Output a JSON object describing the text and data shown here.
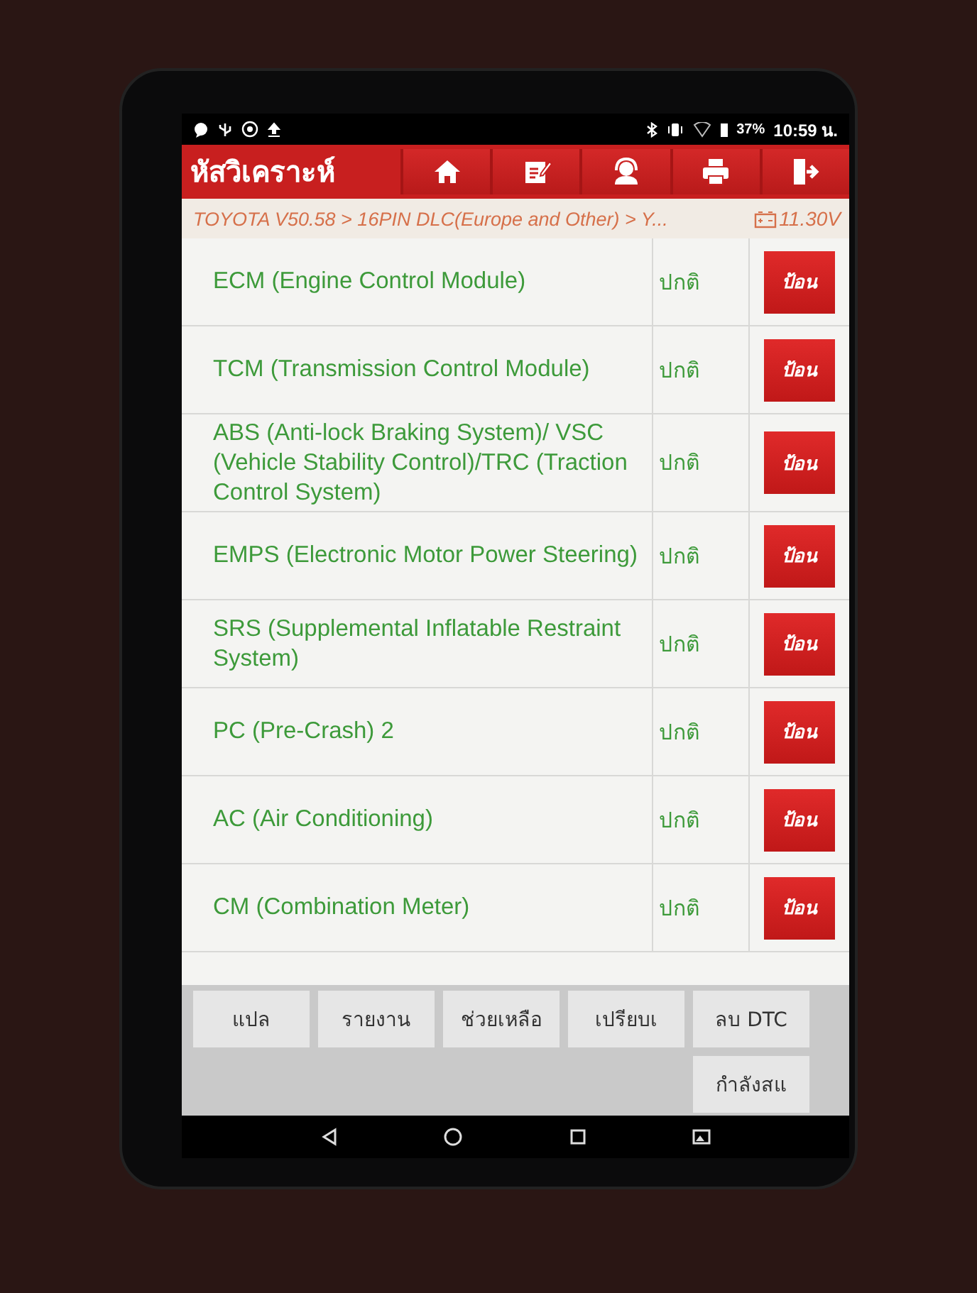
{
  "status_bar": {
    "battery": "37%",
    "time": "10:59 น."
  },
  "header": {
    "title": "หัสวิเคราะห์"
  },
  "breadcrumb": {
    "path": "TOYOTA V50.58 > 16PIN DLC(Europe and Other) > Y...",
    "voltage": "11.30V"
  },
  "systems": [
    {
      "name": "ECM (Engine Control Module)",
      "status": "ปกติ",
      "action": "ป้อน"
    },
    {
      "name": "TCM (Transmission Control Module)",
      "status": "ปกติ",
      "action": "ป้อน"
    },
    {
      "name": "ABS (Anti-lock Braking System)/ VSC (Vehicle Stability Control)/TRC (Traction Control System)",
      "status": "ปกติ",
      "action": "ป้อน"
    },
    {
      "name": "EMPS (Electronic Motor Power Steering)",
      "status": "ปกติ",
      "action": "ป้อน"
    },
    {
      "name": "SRS (Supplemental Inflatable Restraint System)",
      "status": "ปกติ",
      "action": "ป้อน"
    },
    {
      "name": "PC (Pre-Crash) 2",
      "status": "ปกติ",
      "action": "ป้อน"
    },
    {
      "name": "AC (Air Conditioning)",
      "status": "ปกติ",
      "action": "ป้อน"
    },
    {
      "name": "CM (Combination Meter)",
      "status": "ปกติ",
      "action": "ป้อน"
    }
  ],
  "bottom_buttons": [
    "แปล",
    "รายงาน",
    "ช่วยเหลือ",
    "เปรียบเ",
    "ลบ DTC",
    "กำลังสแ"
  ]
}
